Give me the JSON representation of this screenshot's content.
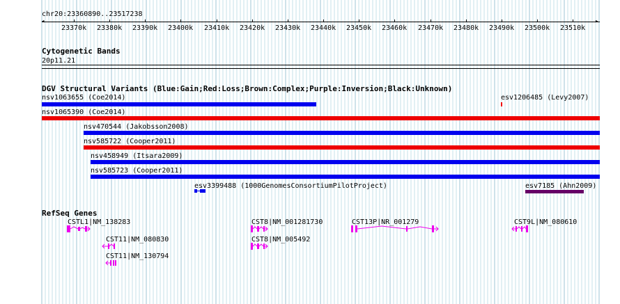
{
  "ruler": {
    "coordinates": "chr20:23360890..23517238",
    "ticks": [
      "23370k",
      "23380k",
      "23390k",
      "23400k",
      "23410k",
      "23420k",
      "23430k",
      "23440k",
      "23450k",
      "23460k",
      "23470k",
      "23480k",
      "23490k",
      "23500k",
      "23510k"
    ]
  },
  "cytoband": {
    "title": "Cytogenetic Bands",
    "band": "20p11.21"
  },
  "dgv": {
    "title": "DGV Structural Variants (Blue:Gain;Red:Loss;Brown:Complex;Purple:Inversion;Black:Unknown)",
    "colors": {
      "gain": "#0000ee",
      "loss": "#ee0000",
      "inversion": "#660066"
    },
    "variants": [
      {
        "id": "nsv1063655 (Coe2014)",
        "type": "gain"
      },
      {
        "id": "esv1206485 (Levy2007)",
        "type": "loss"
      },
      {
        "id": "nsv1065390 (Coe2014)",
        "type": "loss"
      },
      {
        "id": "nsv470544 (Jakobsson2008)",
        "type": "gain"
      },
      {
        "id": "nsv585722 (Cooper2011)",
        "type": "loss"
      },
      {
        "id": "nsv458949 (Itsara2009)",
        "type": "gain"
      },
      {
        "id": "nsv585723 (Cooper2011)",
        "type": "gain"
      },
      {
        "id": "esv3399488 (1000GenomesConsortiumPilotProject)",
        "type": "gain"
      },
      {
        "id": "esv7185 (Ahn2009)",
        "type": "inversion"
      }
    ]
  },
  "refseq": {
    "title": "RefSeq Genes",
    "color": "#ee00ee",
    "genes": [
      {
        "label": "CSTL1|NM_138283"
      },
      {
        "label": "CST11|NM_080830"
      },
      {
        "label": "CST11|NM_130794"
      },
      {
        "label": "CST8|NM_001281730"
      },
      {
        "label": "CST8|NM_005492"
      },
      {
        "label": "CST13P|NR_001279"
      },
      {
        "label": "CST9L|NM_080610"
      }
    ]
  }
}
